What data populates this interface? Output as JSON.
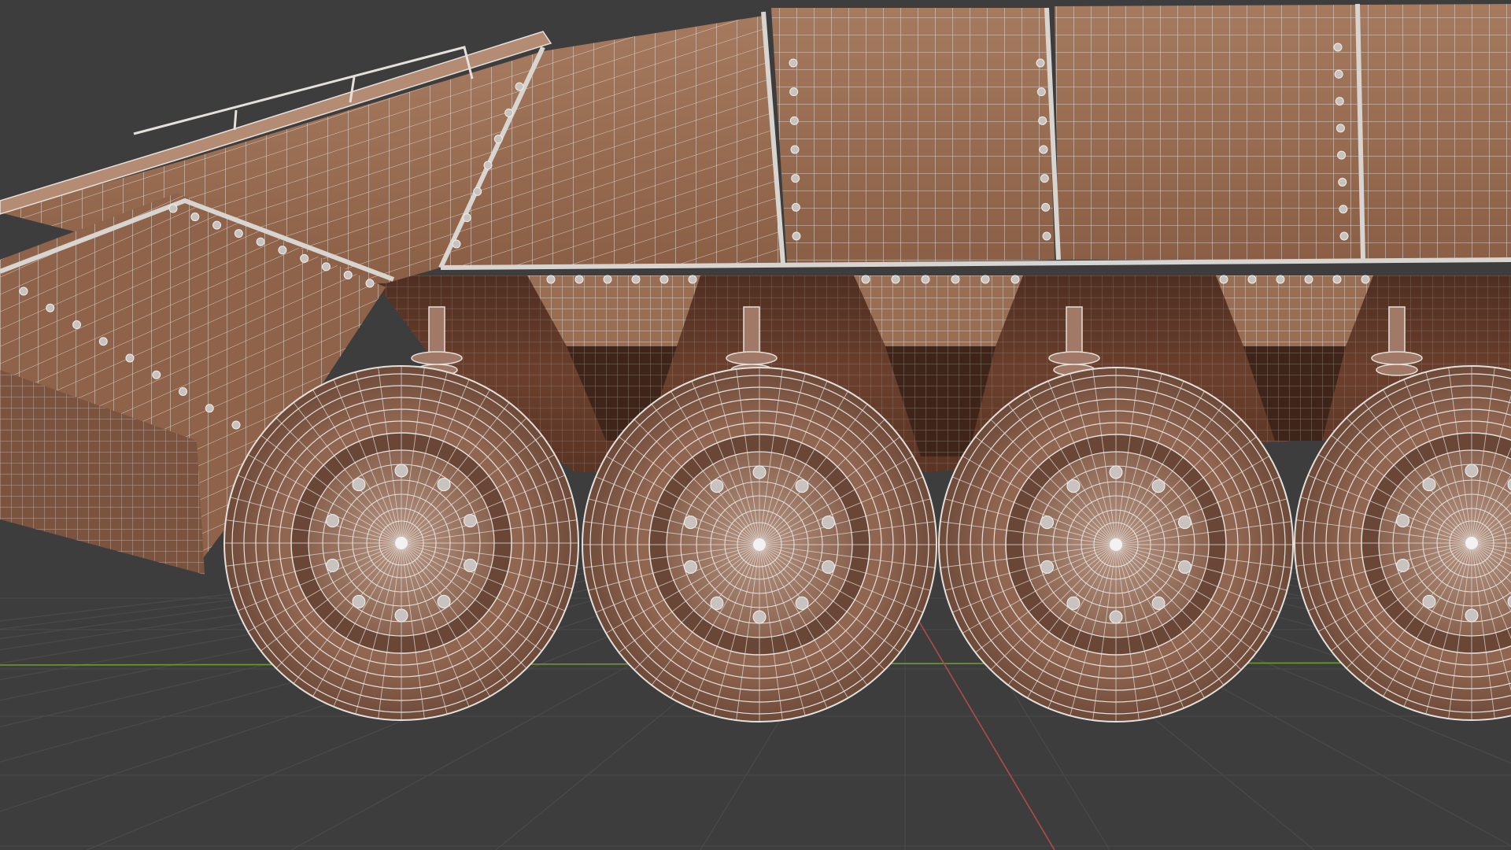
{
  "viewport": {
    "name": "3D Viewport",
    "shading": "solid-wireframe-overlay",
    "background_color": "#3d3d3d",
    "grid_color": "#4a4a4a",
    "x_axis_color": "#b24a4a",
    "y_axis_color": "#6a9b2f"
  },
  "model": {
    "object": "armored-vehicle-8x8",
    "material_color": "#9a6e52",
    "wire_color": "#d9d9d9",
    "visible_wheels": 4
  }
}
